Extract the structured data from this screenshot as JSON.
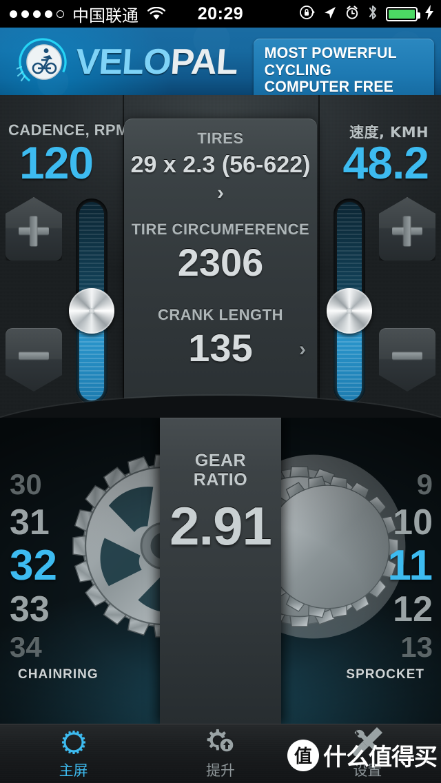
{
  "status_bar": {
    "signal_dots": 5,
    "signal_filled": 4,
    "carrier": "中国联通",
    "wifi_icon": "wifi-icon",
    "time": "20:29",
    "icons": [
      "rotation-lock-icon",
      "location-arrow-icon",
      "alarm-clock-icon",
      "bluetooth-icon"
    ],
    "battery_icon": "battery-icon",
    "charging_icon": "lightning-bolt-icon",
    "battery_color": "#4cd964"
  },
  "header": {
    "logo_icon": "cyclist-badge-icon",
    "logo_velo": "VELO",
    "logo_pal": "PAL",
    "banner_line1": "MOST POWERFUL CYCLING",
    "banner_line2": "COMPUTER FREE APP",
    "banner_color": "#1d79b2"
  },
  "top_panel": {
    "cadence": {
      "label": "CADENCE, RPM",
      "value": "120",
      "plus_label": "+",
      "minus_label": "–",
      "slider_name": "cadence-slider"
    },
    "speed": {
      "label": "速度, KMH",
      "value": "48.2",
      "plus_label": "+",
      "minus_label": "–",
      "slider_name": "speed-slider"
    },
    "accent_color": "#3dbbf0",
    "card": {
      "tires_label": "TIRES",
      "tires_value": "29 x 2.3 (56-622)",
      "tires_chevron": "›",
      "circumference_label": "TIRE CIRCUMFERENCE",
      "circumference_value": "2306",
      "crank_label": "CRANK LENGTH",
      "crank_value": "135",
      "crank_chevron": "›"
    }
  },
  "gear_section": {
    "chainring": {
      "caption": "CHAINRING",
      "items": [
        "30",
        "31",
        "32",
        "33",
        "34"
      ],
      "selected_index": 2,
      "gear_icon": "chainring-cog-icon"
    },
    "sprocket": {
      "caption": "SPROCKET",
      "items": [
        "9",
        "10",
        "11",
        "12",
        "13"
      ],
      "selected_index": 2,
      "gear_icon": "cassette-sprocket-icon"
    },
    "gear_ratio": {
      "label_line1": "GEAR",
      "label_line2": "RATIO",
      "value": "2.91"
    }
  },
  "tab_bar": {
    "tabs": [
      {
        "label": "主屏",
        "icon": "gear-outline-icon",
        "active": true
      },
      {
        "label": "提升",
        "icon": "gear-upgrade-icon",
        "active": false
      },
      {
        "label": "设置",
        "icon": "wrench-screwdriver-icon",
        "active": false
      }
    ],
    "active_color": "#3dbbf0"
  },
  "watermark": {
    "mark": "值",
    "text": "什么值得买"
  }
}
